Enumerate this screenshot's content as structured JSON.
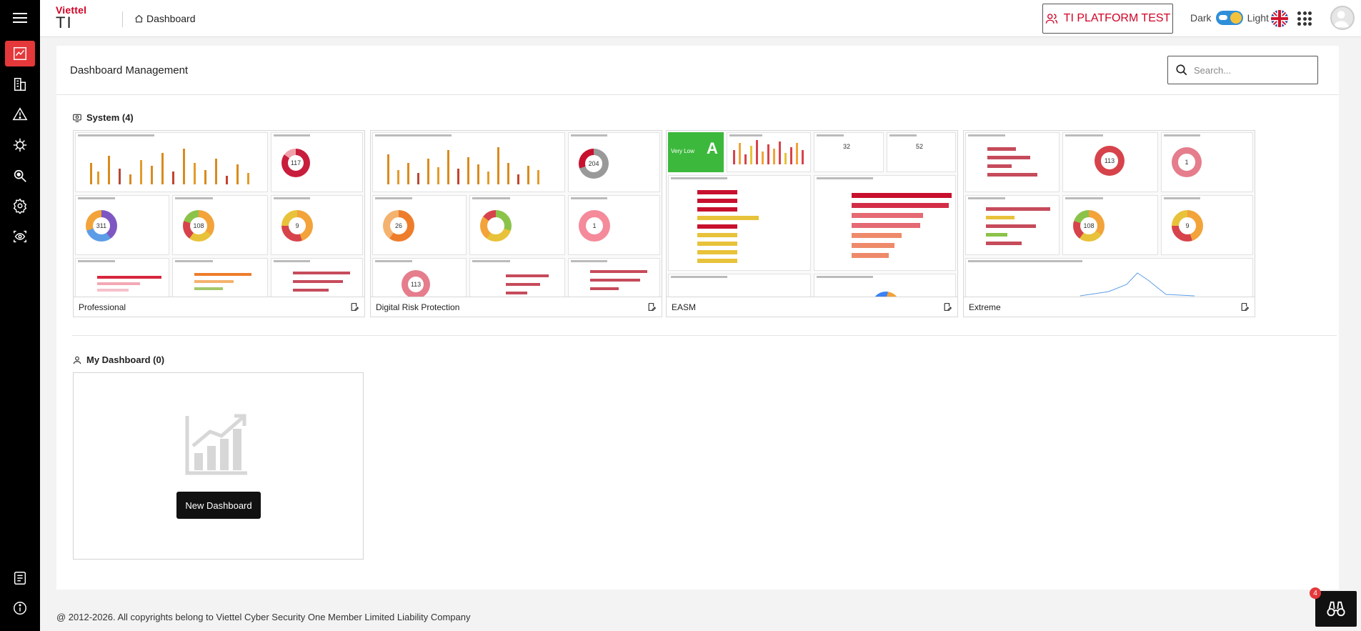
{
  "header": {
    "brand": "Viettel",
    "product": "TI",
    "breadcrumb": "Dashboard",
    "tenant": "TI PLATFORM TEST",
    "theme_dark": "Dark",
    "theme_light": "Light"
  },
  "page": {
    "title": "Dashboard Management",
    "search_placeholder": "Search..."
  },
  "system": {
    "title": "System (4)",
    "cards": [
      {
        "name": "Professional"
      },
      {
        "name": "Digital Risk Protection"
      },
      {
        "name": "EASM"
      },
      {
        "name": "Extreme"
      }
    ]
  },
  "thumb_values": {
    "professional": [
      "117",
      "311",
      "108",
      "9"
    ],
    "drp": [
      "204",
      "26",
      "113",
      "1"
    ],
    "easm": {
      "grade": "A",
      "level": "Very Low",
      "n1": "32",
      "n2": "52"
    },
    "extreme": [
      "113",
      "1",
      "108",
      "9"
    ]
  },
  "my_dashboard": {
    "title": "My Dashboard (0)",
    "new_button": "New Dashboard"
  },
  "footer": {
    "copyright": "@ 2012-2026. All copyrights belong to Viettel Cyber Security One Member Limited Liability Company"
  },
  "notifications": {
    "count": "4"
  },
  "colors": {
    "accent": "#e5383b",
    "brand_red": "#d00024",
    "easm_green": "#3cb93c"
  },
  "icons": {
    "rail": [
      "menu-icon",
      "dashboard-chart-icon",
      "building-icon",
      "warning-icon",
      "virus-icon",
      "search-bug-icon",
      "settings-icon",
      "eye-scan-icon",
      "document-icon",
      "info-icon"
    ]
  }
}
